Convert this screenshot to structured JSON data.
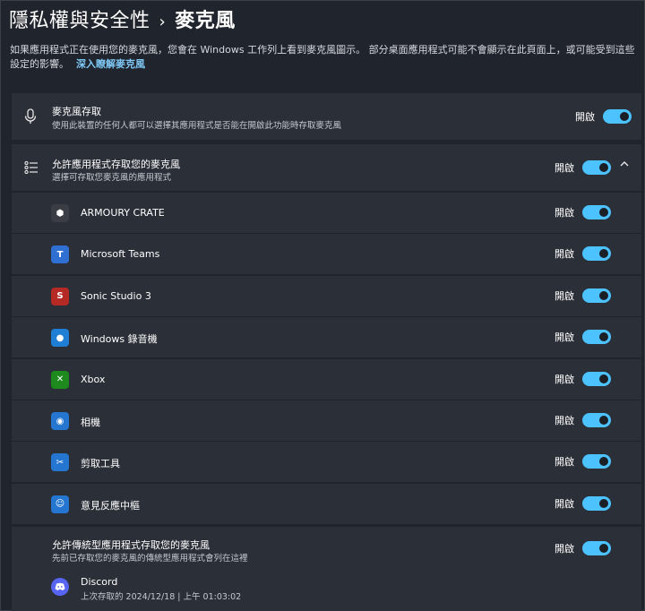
{
  "breadcrumb": {
    "parent": "隱私權與安全性",
    "separator": "›",
    "current": "麥克風"
  },
  "description": {
    "text": "如果應用程式正在使用您的麥克風，您會在 Windows 工作列上看到麥克風圖示。 部分桌面應用程式可能不會顯示在此頁面上，或可能受到這些設定的影響。",
    "link": "深入瞭解麥克風"
  },
  "mic_access": {
    "title": "麥克風存取",
    "subtitle": "使用此裝置的任何人都可以選擇其應用程式是否能在開啟此功能時存取麥克風",
    "state": "開啟"
  },
  "app_access": {
    "title": "允許應用程式存取您的麥克風",
    "subtitle": "選擇可存取您麥克風的應用程式",
    "state": "開啟"
  },
  "apps": [
    {
      "name": "ARMOURY CRATE",
      "state": "開啟",
      "icon": "armoury-crate-icon",
      "color": "#3a3d44"
    },
    {
      "name": "Microsoft Teams",
      "state": "開啟",
      "icon": "teams-icon",
      "color": "#2f6fd1"
    },
    {
      "name": "Sonic Studio 3",
      "state": "開啟",
      "icon": "sonic-studio-icon",
      "color": "#b52a25"
    },
    {
      "name": "Windows 錄音機",
      "state": "開啟",
      "icon": "sound-recorder-icon",
      "color": "#1f7fd4"
    },
    {
      "name": "Xbox",
      "state": "開啟",
      "icon": "xbox-icon",
      "color": "#1e8a1e"
    },
    {
      "name": "相機",
      "state": "開啟",
      "icon": "camera-icon",
      "color": "#2576d0"
    },
    {
      "name": "剪取工具",
      "state": "開啟",
      "icon": "snipping-tool-icon",
      "color": "#2576d0"
    },
    {
      "name": "意見反應中樞",
      "state": "開啟",
      "icon": "feedback-hub-icon",
      "color": "#2576d0"
    }
  ],
  "desktop": {
    "title": "允許傳統型應用程式存取您的麥克風",
    "subtitle": "先前已存取您的麥克風的傳統型應用程式會列在這裡",
    "state": "開啟",
    "app": {
      "name": "Discord",
      "last_access": "上次存取的 2024/12/18 | 上午 01:03:02",
      "icon": "discord-icon",
      "color": "#5865f2"
    }
  },
  "colors": {
    "accent": "#4cc2ff",
    "card": "#2b2f37",
    "background": "#20242c"
  }
}
